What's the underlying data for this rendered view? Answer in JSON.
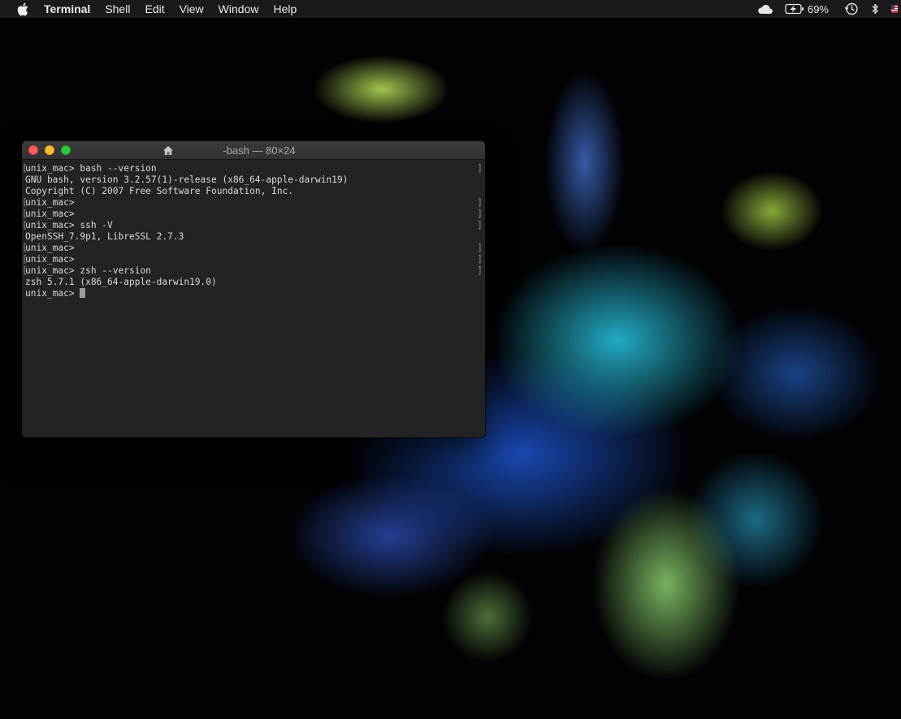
{
  "menubar": {
    "app_name": "Terminal",
    "menus": [
      "Shell",
      "Edit",
      "View",
      "Window",
      "Help"
    ],
    "status": {
      "icons": [
        "cloud-icon",
        "battery-charging-icon",
        "time-machine-icon",
        "bluetooth-icon"
      ],
      "battery_percent": "69%"
    }
  },
  "terminal": {
    "title": "-bash — 80×24",
    "lines": [
      {
        "text": "unix_mac> bash --version",
        "marked": true
      },
      {
        "text": "GNU bash, version 3.2.57(1)-release (x86_64-apple-darwin19)",
        "marked": false
      },
      {
        "text": "Copyright (C) 2007 Free Software Foundation, Inc.",
        "marked": false
      },
      {
        "text": "unix_mac>",
        "marked": true
      },
      {
        "text": "unix_mac>",
        "marked": true
      },
      {
        "text": "unix_mac> ssh -V",
        "marked": true
      },
      {
        "text": "OpenSSH_7.9p1, LibreSSL 2.7.3",
        "marked": false
      },
      {
        "text": "unix_mac>",
        "marked": true
      },
      {
        "text": "unix_mac>",
        "marked": true
      },
      {
        "text": "unix_mac> zsh --version",
        "marked": true
      },
      {
        "text": "zsh 5.7.1 (x86_64-apple-darwin19.0)",
        "marked": false
      }
    ],
    "prompt": "unix_mac> "
  },
  "colors": {
    "terminal_bg": "#232323",
    "terminal_text": "#d9d9d9",
    "close": "#fe5f57",
    "minimize": "#febc2e",
    "maximize": "#28c840"
  }
}
